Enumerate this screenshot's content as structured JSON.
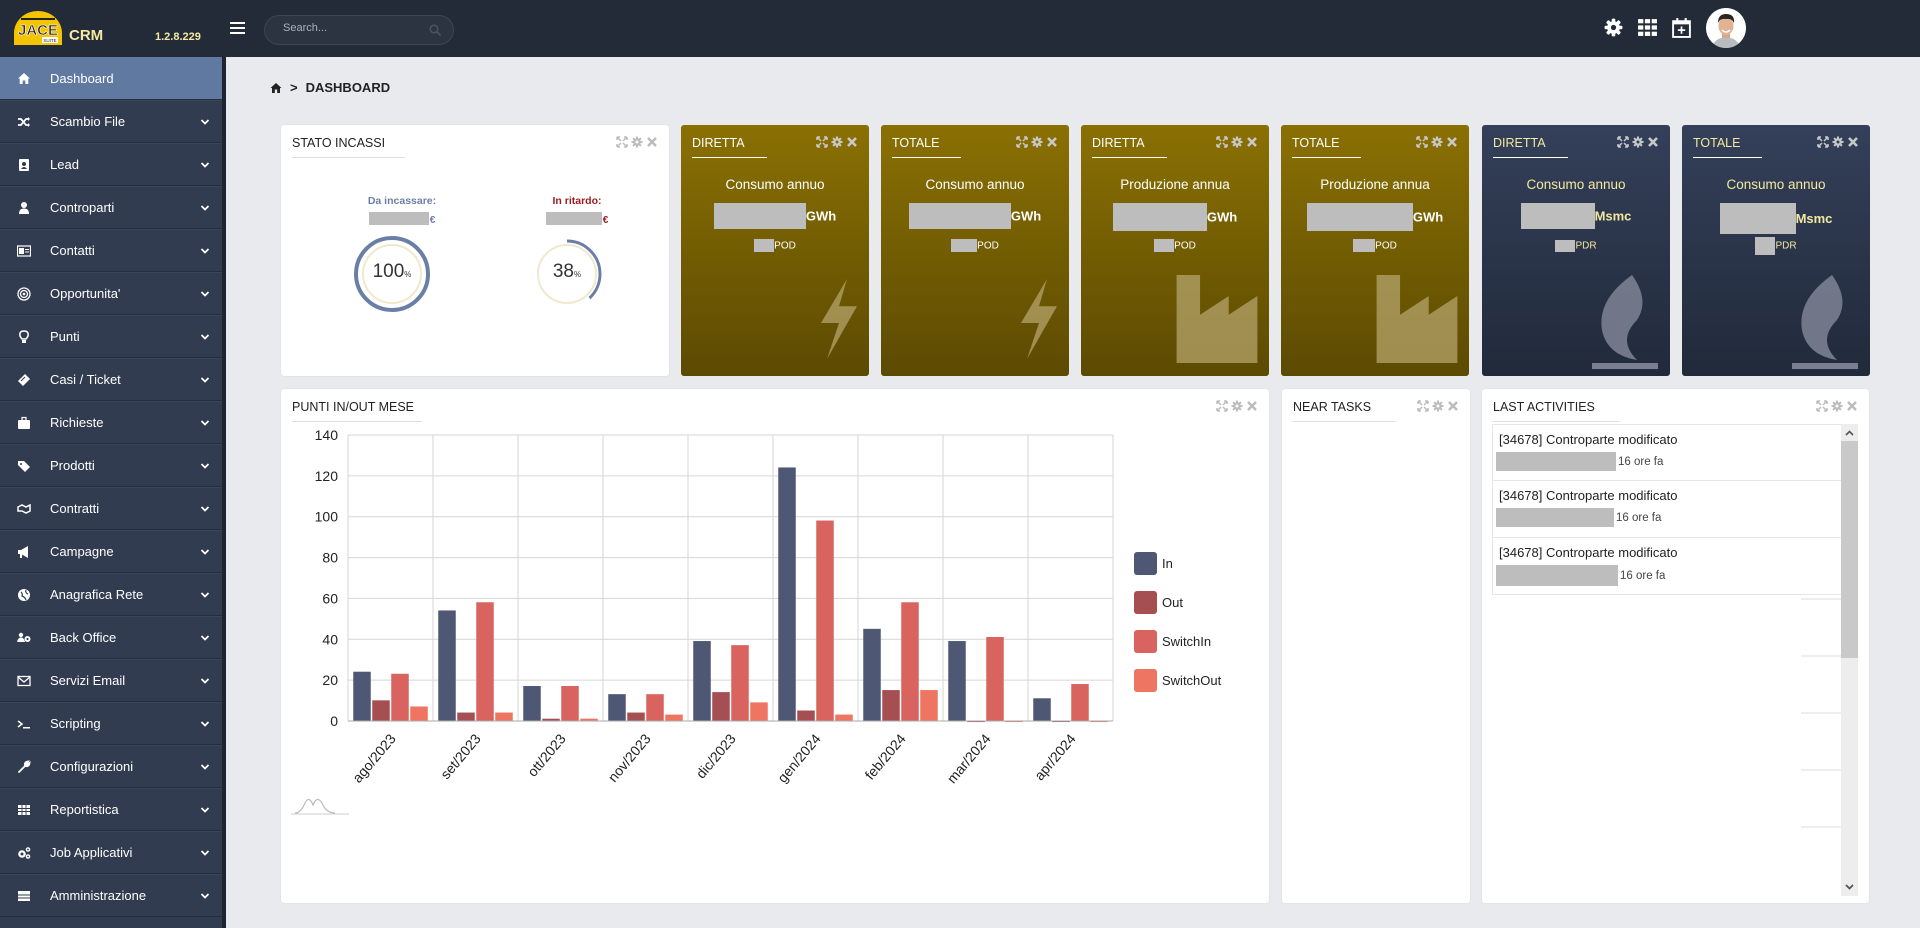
{
  "app": {
    "logo_text": "JACE",
    "logo_sub": "SUITE",
    "name": "CRM",
    "version": "1.2.8.229"
  },
  "header": {
    "search_placeholder": "Search...",
    "icons": [
      "gear-icon",
      "apps-grid-icon",
      "calendar-plus-icon"
    ],
    "avatar": "user-avatar"
  },
  "sidebar": {
    "items": [
      {
        "label": "Dashboard",
        "icon": "home-icon",
        "active": true,
        "expandable": false
      },
      {
        "label": "Scambio File",
        "icon": "shuffle-icon",
        "expandable": true
      },
      {
        "label": "Lead",
        "icon": "contact-book-icon",
        "expandable": true
      },
      {
        "label": "Controparti",
        "icon": "user-icon",
        "expandable": true
      },
      {
        "label": "Contatti",
        "icon": "id-card-icon",
        "expandable": true
      },
      {
        "label": "Opportunita'",
        "icon": "target-icon",
        "expandable": true
      },
      {
        "label": "Punti",
        "icon": "lightbulb-icon",
        "expandable": true
      },
      {
        "label": "Casi / Ticket",
        "icon": "ticket-icon",
        "expandable": true
      },
      {
        "label": "Richieste",
        "icon": "briefcase-icon",
        "expandable": true
      },
      {
        "label": "Prodotti",
        "icon": "tags-icon",
        "expandable": true
      },
      {
        "label": "Contratti",
        "icon": "handshake-icon",
        "expandable": true
      },
      {
        "label": "Campagne",
        "icon": "megaphone-icon",
        "expandable": true
      },
      {
        "label": "Anagrafica Rete",
        "icon": "globe-icon",
        "expandable": true
      },
      {
        "label": "Back Office",
        "icon": "users-cog-icon",
        "expandable": true
      },
      {
        "label": "Servizi Email",
        "icon": "envelope-icon",
        "expandable": true
      },
      {
        "label": "Scripting",
        "icon": "terminal-icon",
        "expandable": true
      },
      {
        "label": "Configurazioni",
        "icon": "wrench-icon",
        "expandable": true
      },
      {
        "label": "Reportistica",
        "icon": "table-icon",
        "expandable": true
      },
      {
        "label": "Job Applicativi",
        "icon": "cogs-icon",
        "expandable": true
      },
      {
        "label": "Amministrazione",
        "icon": "server-icon",
        "expandable": true
      }
    ]
  },
  "breadcrumb": {
    "separator": ">",
    "current": "DASHBOARD"
  },
  "stato_incassi": {
    "title": "STATO INCASSI",
    "da_incassare": {
      "label": "Da incassare:",
      "currency": "€",
      "percent": 100,
      "percent_label": "100",
      "color": "#6b7fa6"
    },
    "in_ritardo": {
      "label": "In ritardo:",
      "currency": "€",
      "percent": 38,
      "percent_label": "38",
      "color": "#9b1c1c"
    },
    "percent_sign": "%"
  },
  "kpis": [
    {
      "tab": "DIRETTA",
      "subtitle": "Consumo annuo",
      "unit": "GWh",
      "count_label": "POD",
      "theme": "gold",
      "icon": "bolt-icon"
    },
    {
      "tab": "TOTALE",
      "subtitle": "Consumo annuo",
      "unit": "GWh",
      "count_label": "POD",
      "theme": "gold",
      "icon": "bolt-icon"
    },
    {
      "tab": "DIRETTA",
      "subtitle": "Produzione annua",
      "unit": "GWh",
      "count_label": "POD",
      "theme": "gold",
      "icon": "factory-icon"
    },
    {
      "tab": "TOTALE",
      "subtitle": "Produzione annua",
      "unit": "GWh",
      "count_label": "POD",
      "theme": "gold",
      "icon": "factory-icon"
    },
    {
      "tab": "DIRETTA",
      "subtitle": "Consumo annuo",
      "unit": "Msmc",
      "count_label": "PDR",
      "theme": "navy",
      "icon": "gas-flame-icon"
    },
    {
      "tab": "TOTALE",
      "subtitle": "Consumo annuo",
      "unit": "Msmc",
      "count_label": "PDR",
      "theme": "navy",
      "icon": "gas-flame-icon"
    }
  ],
  "punti_panel": {
    "title": "PUNTI IN/OUT MESE"
  },
  "near_tasks": {
    "title": "NEAR TASKS",
    "items": []
  },
  "last_activities": {
    "title": "LAST ACTIVITIES",
    "items": [
      {
        "title": "[34678] Controparte modificato",
        "time": "16 ore fa"
      },
      {
        "title": "[34678] Controparte modificato",
        "time": "16 ore fa"
      },
      {
        "title": "[34678] Controparte modificato",
        "time": "16 ore fa"
      }
    ]
  },
  "chart_data": {
    "type": "bar",
    "title": "PUNTI IN/OUT MESE",
    "xlabel": "",
    "ylabel": "",
    "categories": [
      "ago/2023",
      "set/2023",
      "ott/2023",
      "nov/2023",
      "dic/2023",
      "gen/2024",
      "feb/2024",
      "mar/2024",
      "apr/2024"
    ],
    "series": [
      {
        "name": "In",
        "color": "#4e5874",
        "values": [
          24,
          54,
          17,
          13,
          39,
          124,
          45,
          39,
          11
        ]
      },
      {
        "name": "Out",
        "color": "#a54f52",
        "values": [
          10,
          4,
          1,
          4,
          14,
          5,
          15,
          0,
          0
        ]
      },
      {
        "name": "SwitchIn",
        "color": "#d9645f",
        "values": [
          23,
          58,
          17,
          13,
          37,
          98,
          58,
          41,
          18
        ]
      },
      {
        "name": "SwitchOut",
        "color": "#ee7561",
        "values": [
          7,
          4,
          1,
          3,
          9,
          3,
          15,
          0,
          0
        ]
      }
    ],
    "ylim": [
      0,
      140
    ],
    "yticks": [
      0,
      20,
      40,
      60,
      80,
      100,
      120,
      140
    ],
    "grid": true,
    "legend": "right"
  }
}
